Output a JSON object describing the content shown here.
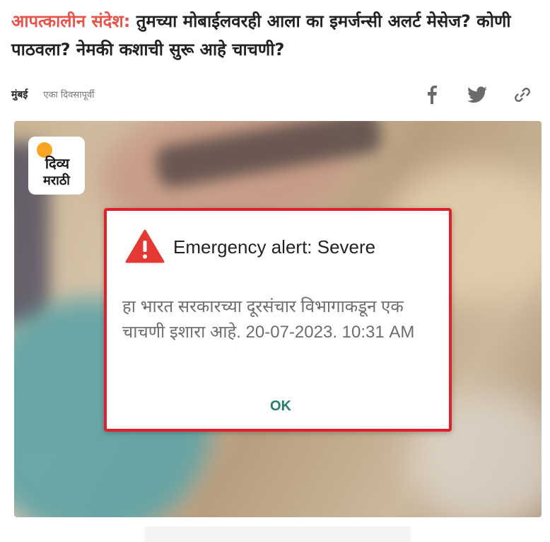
{
  "article": {
    "kicker": "आपत्कालीन संदेश:",
    "headline": "तुमच्या मोबाईलवरही आला का इमर्जन्सी अलर्ट मेसेज? कोणी पाठवला? नेमकी कशाची सुरू आहे चाचणी?",
    "city": "मुंबई",
    "time": "एका दिवसापूर्वी"
  },
  "share": {
    "icons": [
      "facebook-icon",
      "twitter-icon",
      "link-icon"
    ],
    "icon_color": "#6b6b6b"
  },
  "logo": {
    "line1": "दिव्य",
    "line2": "मराठी"
  },
  "alert": {
    "title": "Emergency alert: Severe",
    "body": "हा भारत सरकारच्या दूरसंचार विभागाकडून एक चाचणी इशारा आहे. 20-07-2023. 10:31 AM",
    "ok_label": "OK",
    "border_color": "#e0202a",
    "warning_icon_color": "#e53935"
  },
  "colors": {
    "kicker": "#e8534a",
    "ok_text": "#2a7d6e"
  }
}
